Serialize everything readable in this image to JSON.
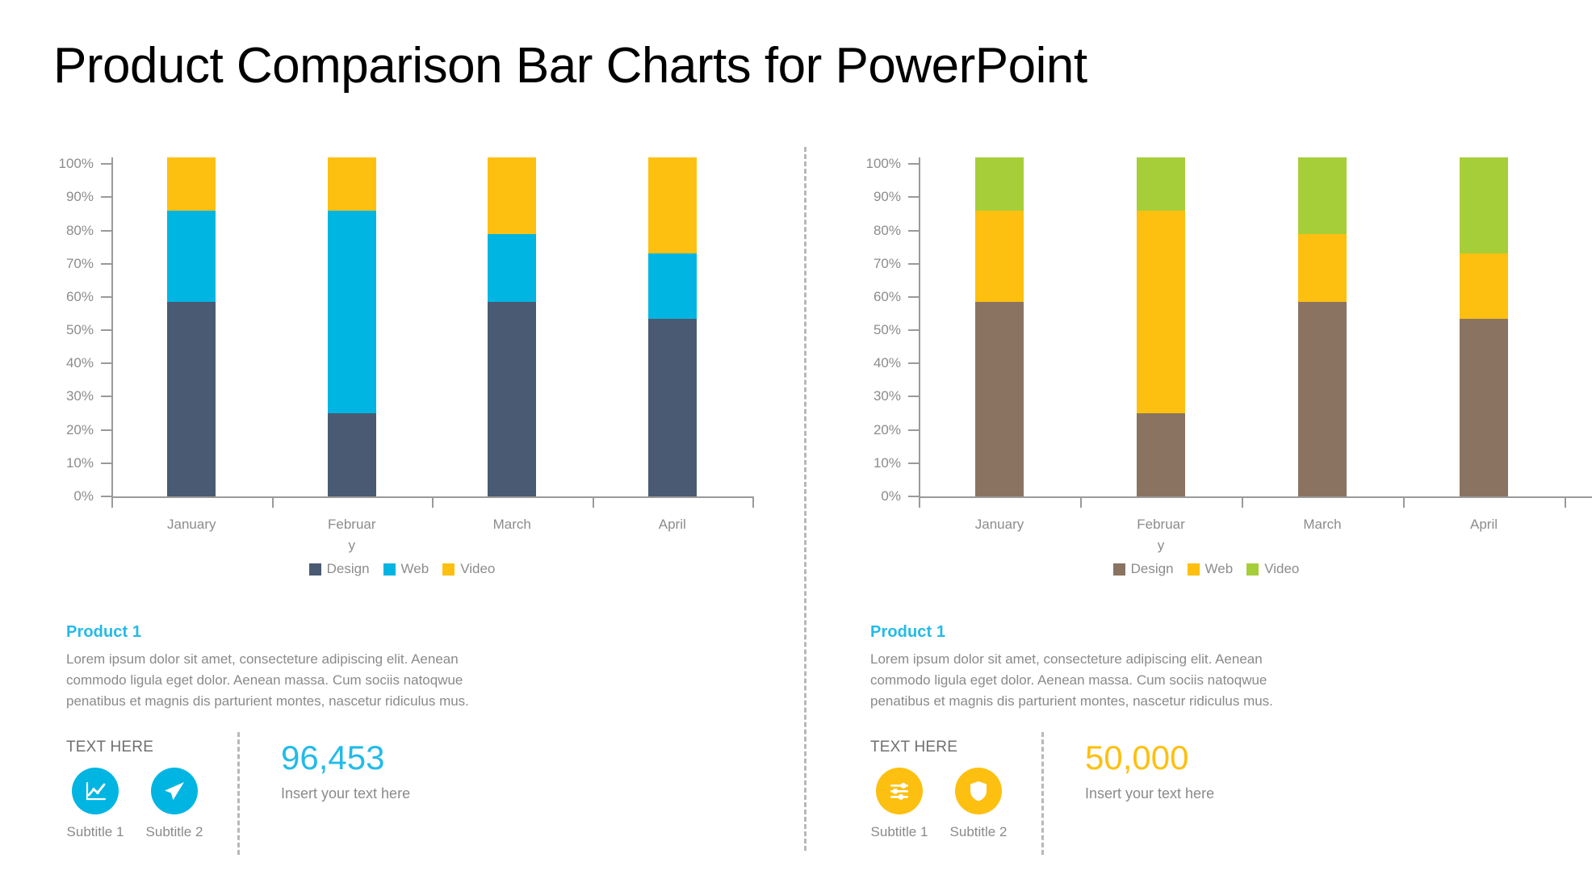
{
  "title": "Product Comparison Bar Charts for PowerPoint",
  "colors": {
    "cyan": "#00b5e2",
    "cyan_text": "#23bbe8",
    "yellow": "#fdc010",
    "dark_slate": "#4a5a73",
    "brown": "#8a7361",
    "green": "#a6ce39",
    "axis_gray": "#9a9a9a",
    "label_gray": "#8c8c8c",
    "body_gray": "#8a8a8a"
  },
  "panels": [
    {
      "id": "left",
      "chart_ref": 0,
      "product": {
        "title": "Product 1",
        "body": "Lorem ipsum dolor sit amet, consecteture adipiscing elit. Aenean commodo ligula eget dolor. Aenean massa. Cum sociis natoqwue penatibus et magnis dis parturient montes, nascetur ridiculus mus."
      },
      "stats": {
        "text_here": "TEXT HERE",
        "accent": "#00b5e2",
        "icons": [
          {
            "icon": "line-chart-icon",
            "caption": "Subtitle 1"
          },
          {
            "icon": "paper-plane-icon",
            "caption": "Subtitle 2"
          }
        ],
        "number": "96,453",
        "number_color": "#23bbe8",
        "caption": "Insert your text here"
      }
    },
    {
      "id": "right",
      "chart_ref": 1,
      "product": {
        "title": "Product 1",
        "body": "Lorem ipsum dolor sit amet, consecteture adipiscing elit. Aenean commodo ligula eget dolor. Aenean massa. Cum sociis natoqwue penatibus et magnis dis parturient montes, nascetur ridiculus mus."
      },
      "stats": {
        "text_here": "TEXT HERE",
        "accent": "#fdc010",
        "icons": [
          {
            "icon": "sliders-icon",
            "caption": "Subtitle 1"
          },
          {
            "icon": "shield-icon",
            "caption": "Subtitle 2"
          }
        ],
        "number": "50,000",
        "number_color": "#fdc010",
        "caption": "Insert your text here"
      }
    }
  ],
  "chart_data": [
    {
      "type": "bar",
      "stacked": true,
      "title": "",
      "xlabel": "",
      "ylabel": "",
      "ylim": [
        0,
        100
      ],
      "yticks": [
        0,
        10,
        20,
        30,
        40,
        50,
        60,
        70,
        80,
        90,
        100
      ],
      "ytick_labels": [
        "0%",
        "10%",
        "20%",
        "30%",
        "40%",
        "50%",
        "60%",
        "70%",
        "80%",
        "90%",
        "100%"
      ],
      "grid": false,
      "legend_position": "bottom",
      "categories": [
        "January",
        "February",
        "March",
        "April"
      ],
      "series": [
        {
          "name": "Design",
          "color": "#4a5a73",
          "values": [
            58.5,
            25.0,
            58.5,
            53.5
          ]
        },
        {
          "name": "Web",
          "color": "#00b5e2",
          "values": [
            27.5,
            61.0,
            20.5,
            19.5
          ]
        },
        {
          "name": "Video",
          "color": "#fdc010",
          "values": [
            16.0,
            16.0,
            23.0,
            29.0
          ]
        }
      ]
    },
    {
      "type": "bar",
      "stacked": true,
      "title": "",
      "xlabel": "",
      "ylabel": "",
      "ylim": [
        0,
        100
      ],
      "yticks": [
        0,
        10,
        20,
        30,
        40,
        50,
        60,
        70,
        80,
        90,
        100
      ],
      "ytick_labels": [
        "0%",
        "10%",
        "20%",
        "30%",
        "40%",
        "50%",
        "60%",
        "70%",
        "80%",
        "90%",
        "100%"
      ],
      "grid": false,
      "legend_position": "bottom",
      "categories": [
        "January",
        "February",
        "March",
        "April"
      ],
      "series": [
        {
          "name": "Design",
          "color": "#8a7361",
          "values": [
            58.5,
            25.0,
            58.5,
            53.5
          ]
        },
        {
          "name": "Web",
          "color": "#fdc010",
          "values": [
            27.5,
            61.0,
            20.5,
            19.5
          ]
        },
        {
          "name": "Video",
          "color": "#a6ce39",
          "values": [
            16.0,
            16.0,
            23.0,
            29.0
          ]
        }
      ]
    }
  ]
}
